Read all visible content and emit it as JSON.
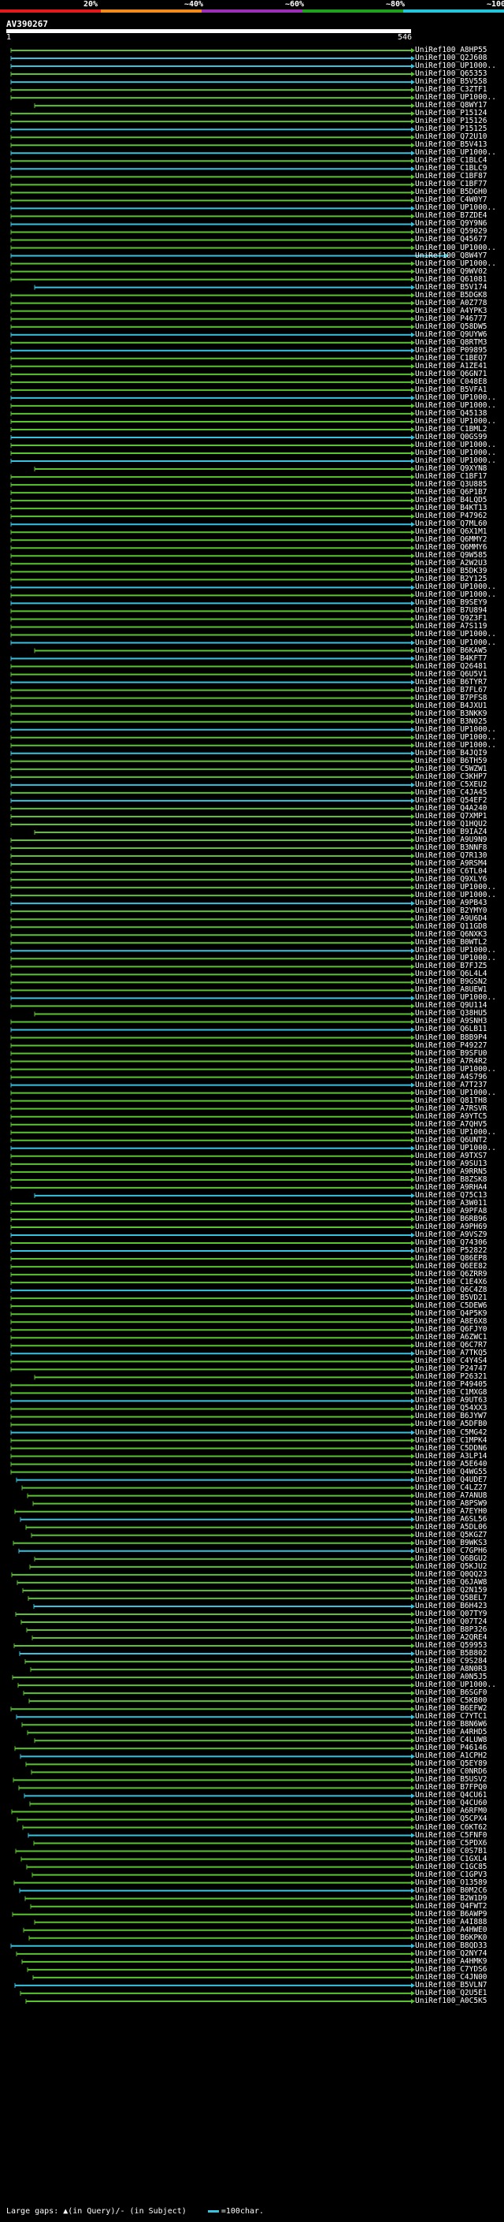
{
  "scale": {
    "labels": [
      "20%",
      "~40%",
      "~60%",
      "~80%",
      "~100%"
    ],
    "colors": [
      "#e11b1b",
      "#f08a1a",
      "#9b2fb5",
      "#1fa01f",
      "#26c6da"
    ]
  },
  "query": {
    "id": "AV390267",
    "start": "1",
    "end": "546"
  },
  "colors": {
    "green": "#59c430",
    "cyan": "#36c3e0",
    "white": "#ffffff"
  },
  "hits": [
    "UniRef100_A8HP55",
    "UniRef100_Q2J608",
    "UniRef100_UP1000..",
    "UniRef100_Q65353",
    "UniRef100_B5V558",
    "UniRef100_C3ZTF1",
    "UniRef100_UP1000..",
    "UniRef100_Q8WY17",
    "UniRef100_P15124",
    "UniRef100_P15126",
    "UniRef100_P15125",
    "UniRef100_Q72U10",
    "UniRef100_B5V413",
    "UniRef100_UP1000..",
    "UniRef100_C1BLC4",
    "UniRef100_C1BLC9",
    "UniRef100_C1BF87",
    "UniRef100_C1BF77",
    "UniRef100_B5DGH0",
    "UniRef100_C4W0Y7",
    "UniRef100_UP1000..",
    "UniRef100_B7ZDE4",
    "UniRef100_Q9Y9N6",
    "UniRef100_Q59029",
    "UniRef100_Q45677",
    "UniRef100_UP1000..",
    "UniRef100_Q8W4Y7",
    "UniRef100_UP1000..",
    "UniRef100_Q9WV02",
    "UniRef100_Q61081",
    "UniRef100_B5V174",
    "UniRef100_B5DGK8",
    "UniRef100_A0Z778",
    "UniRef100_A4YPK3",
    "UniRef100_P46777",
    "UniRef100_Q58DW5",
    "UniRef100_Q9UYW6",
    "UniRef100_Q8RTM3",
    "UniRef100_P09895",
    "UniRef100_C1BEQ7",
    "UniRef100_A1ZE41",
    "UniRef100_Q6GN71",
    "UniRef100_C048E8",
    "UniRef100_B5VFA1",
    "UniRef100_UP1000..",
    "UniRef100_UP1000..",
    "UniRef100_Q45138",
    "UniRef100_UP1000..",
    "UniRef100_C1BML2",
    "UniRef100_Q0GS99",
    "UniRef100_UP1000..",
    "UniRef100_UP1000..",
    "UniRef100_UP1000..",
    "UniRef100_Q9XYN8",
    "UniRef100_C1BF17",
    "UniRef100_Q3U885",
    "UniRef100_Q6P1B7",
    "UniRef100_B4LQD5",
    "UniRef100_B4KT13",
    "UniRef100_P47962",
    "UniRef100_Q7ML60",
    "UniRef100_Q6X1M1",
    "UniRef100_Q6MMY2",
    "UniRef100_Q6MMY6",
    "UniRef100_Q9W585",
    "UniRef100_A2W2U3",
    "UniRef100_B5DK39",
    "UniRef100_B2Y125",
    "UniRef100_UP1000..",
    "UniRef100_UP1000..",
    "UniRef100_B9SEY9",
    "UniRef100_B7U894",
    "UniRef100_Q9Z3F1",
    "UniRef100_A7S119",
    "UniRef100_UP1000..",
    "UniRef100_UP1000..",
    "UniRef100_B6KAW5",
    "UniRef100_B4KFT7",
    "UniRef100_Q26481",
    "UniRef100_Q6U5V1",
    "UniRef100_B6TYR7",
    "UniRef100_B7FL67",
    "UniRef100_B7PFS8",
    "UniRef100_B4JXU1",
    "UniRef100_B3NKK9",
    "UniRef100_B3N025",
    "UniRef100_UP1000..",
    "UniRef100_UP1000..",
    "UniRef100_UP1000..",
    "UniRef100_B4JQI9",
    "UniRef100_B6TH59",
    "UniRef100_C5WZW1",
    "UniRef100_C3KHP7",
    "UniRef100_C5XEU2",
    "UniRef100_C4JA45",
    "UniRef100_Q54EF2",
    "UniRef100_Q4A240",
    "UniRef100_Q7XMP1",
    "UniRef100_Q1HQU2",
    "UniRef100_B9IAZ4",
    "UniRef100_A9U9N9",
    "UniRef100_B3NNF8",
    "UniRef100_Q7R130",
    "UniRef100_A9RSM4",
    "UniRef100_C6TL04",
    "UniRef100_Q9XLY6",
    "UniRef100_UP1000..",
    "UniRef100_UP1000..",
    "UniRef100_A9PB43",
    "UniRef100_B2YMY0",
    "UniRef100_A9U6D4",
    "UniRef100_Q11GD8",
    "UniRef100_Q6NXK3",
    "UniRef100_B0WTL2",
    "UniRef100_UP1000..",
    "UniRef100_UP1000..",
    "UniRef100_B7FJZ5",
    "UniRef100_Q6L4L4",
    "UniRef100_B9GSN2",
    "UniRef100_A8UEW1",
    "UniRef100_UP1000..",
    "UniRef100_Q9U114",
    "UniRef100_Q38HU5",
    "UniRef100_A9SNH3",
    "UniRef100_Q6LB11",
    "UniRef100_B8B9P4",
    "UniRef100_P49227",
    "UniRef100_B9SFU0",
    "UniRef100_A7R4R2",
    "UniRef100_UP1000..",
    "UniRef100_A4S796",
    "UniRef100_A7T237",
    "UniRef100_UP1000..",
    "UniRef100_Q81TH8",
    "UniRef100_A7RSVR",
    "UniRef100_A9YTC5",
    "UniRef100_A7QHV5",
    "UniRef100_UP1000..",
    "UniRef100_Q6UNT2",
    "UniRef100_UP1000..",
    "UniRef100_A9TXS7",
    "UniRef100_A9SU13",
    "UniRef100_A9RRN5",
    "UniRef100_B8ZSK8",
    "UniRef100_A9RHA4",
    "UniRef100_Q75C13",
    "UniRef100_A3W011",
    "UniRef100_A9PFA8",
    "UniRef100_B6RB96",
    "UniRef100_A9PH69",
    "UniRef100_A9VSZ9",
    "UniRef100_Q74306",
    "UniRef100_P52822",
    "UniRef100_Q86EP8",
    "UniRef100_Q6EE82",
    "UniRef100_Q6ZRR9",
    "UniRef100_C1E4X6",
    "UniRef100_Q6C4Z8",
    "UniRef100_B5VD21",
    "UniRef100_C5DEW6",
    "UniRef100_Q4P5K9",
    "UniRef100_A8E6X8",
    "UniRef100_Q6FJY0",
    "UniRef100_A6ZWC1",
    "UniRef100_Q6C7R7",
    "UniRef100_A7TKQ5",
    "UniRef100_C4Y4S4",
    "UniRef100_P24747",
    "UniRef100_P26321",
    "UniRef100_P49405",
    "UniRef100_C1MXG8",
    "UniRef100_A9UT63",
    "UniRef100_Q54XX3",
    "UniRef100_B6JYW7",
    "UniRef100_A5DFB0",
    "UniRef100_C5MG42",
    "UniRef100_C1MPK4",
    "UniRef100_C5DDN6",
    "UniRef100_A3LP14",
    "UniRef100_A5E640",
    "UniRef100_Q4WG55",
    "UniRef100_Q4UDE7",
    "UniRef100_C4LZ27",
    "UniRef100_A7ANU8",
    "UniRef100_A8PSW9",
    "UniRef100_A7EYH0",
    "UniRef100_A6SL56",
    "UniRef100_A5DL06",
    "UniRef100_Q5KGZ7",
    "UniRef100_B9WKS3",
    "UniRef100_C7GPH6",
    "UniRef100_Q6BGU2",
    "UniRef100_Q5KJU2",
    "UniRef100_Q0QQ23",
    "UniRef100_Q6JAW8",
    "UniRef100_Q2N159",
    "UniRef100_Q5BEL7",
    "UniRef100_B6H423",
    "UniRef100_Q07TY9",
    "UniRef100_Q07T24",
    "UniRef100_B8P326",
    "UniRef100_A2QRE4",
    "UniRef100_Q59953",
    "UniRef100_B5B802",
    "UniRef100_C9S284",
    "UniRef100_A8N0R3",
    "UniRef100_A0N5J5",
    "UniRef100_UP1000..",
    "UniRef100_B6SGF0",
    "UniRef100_C5KB00",
    "UniRef100_B6EFW2",
    "UniRef100_C7YTC1",
    "UniRef100_B8N6W6",
    "UniRef100_A4RHD5",
    "UniRef100_C4LUW8",
    "UniRef100_P46146",
    "UniRef100_A1CPH2",
    "UniRef100_Q5EY89",
    "UniRef100_C0NRD6",
    "UniRef100_B5USV2",
    "UniRef100_B7FPQ0",
    "UniRef100_Q4CU61",
    "UniRef100_Q4CU60",
    "UniRef100_A6RFM0",
    "UniRef100_Q5CPX4",
    "UniRef100_C6KT62",
    "UniRef100_C5FNF0",
    "UniRef100_C5PDX6",
    "UniRef100_C0S7B1",
    "UniRef100_C1GXL4",
    "UniRef100_C1GC85",
    "UniRef100_C1GPV3",
    "UniRef100_O13589",
    "UniRef100_B0M2C6",
    "UniRef100_B2W1D9",
    "UniRef100_Q4FWT2",
    "UniRef100_B6AWP9",
    "UniRef100_A4I888",
    "UniRef100_A4HWE0",
    "UniRef100_B6KPK0",
    "UniRef100_B8QD33",
    "UniRef100_Q2NY74",
    "UniRef100_A4HMK9",
    "UniRef100_C7YDS6",
    "UniRef100_C4JN00",
    "UniRef100_B5VLN7",
    "UniRef100_Q2U5E1",
    "UniRef100_A0C5K5"
  ],
  "footer": {
    "gaps_text": "Large gaps: ▲(in Query)/- (in Subject)",
    "legend_text": "=100char."
  }
}
